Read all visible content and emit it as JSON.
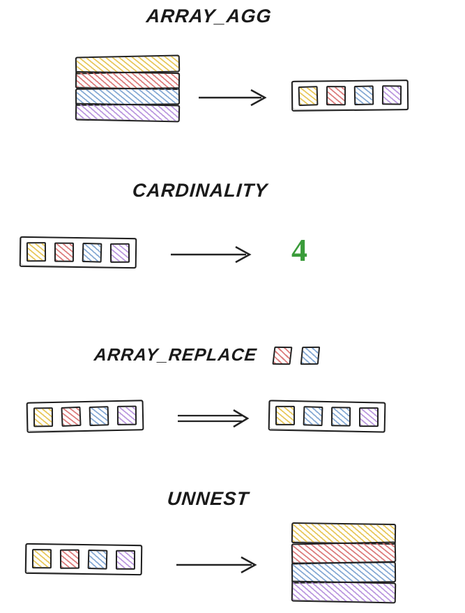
{
  "sections": {
    "array_agg": {
      "title": "ARRAY_AGG",
      "input_stack_colors": [
        "yellow",
        "red",
        "blue",
        "purple"
      ],
      "output_array_colors": [
        "yellow",
        "red",
        "blue",
        "purple"
      ]
    },
    "cardinality": {
      "title": "CARDINALITY",
      "input_array_colors": [
        "yellow",
        "red",
        "blue",
        "purple"
      ],
      "output_number": "4"
    },
    "array_replace": {
      "title": "ARRAY_REPLACE",
      "title_swatches": [
        "red",
        "blue"
      ],
      "input_array_colors": [
        "yellow",
        "red",
        "blue",
        "purple"
      ],
      "output_array_colors": [
        "yellow",
        "blue",
        "blue",
        "purple"
      ]
    },
    "unnest": {
      "title": "UNNEST",
      "input_array_colors": [
        "yellow",
        "red",
        "blue",
        "purple"
      ],
      "output_stack_colors": [
        "yellow",
        "red",
        "blue",
        "purple"
      ]
    }
  },
  "colors": {
    "yellow": "#e6c24a",
    "red": "#d97070",
    "blue": "#7aa0d0",
    "purple": "#b48edc",
    "ink": "#1a1a1a",
    "output_number": "#3a9c3a"
  }
}
